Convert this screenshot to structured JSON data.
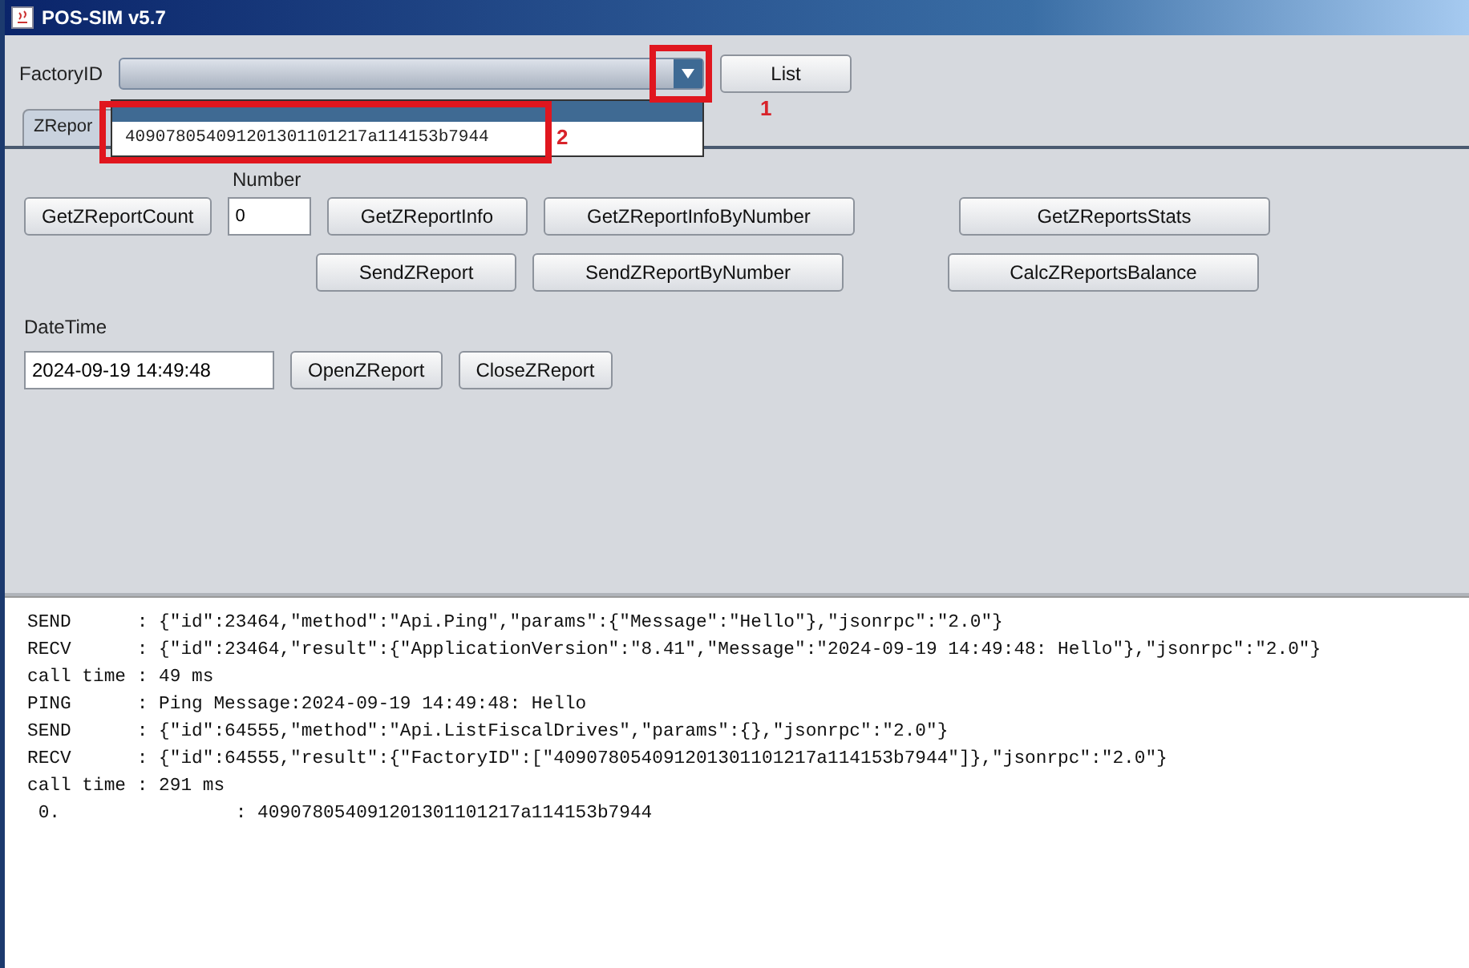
{
  "window": {
    "title": "POS-SIM v5.7"
  },
  "factory": {
    "label": "FactoryID",
    "open": true,
    "list_button": "List",
    "items": [
      {
        "selected": true
      },
      {
        "text": "409078054091201301101217a114153b7944",
        "selected": false
      }
    ]
  },
  "tabs": [
    {
      "label": "ZRepor",
      "selected": true
    }
  ],
  "panel": {
    "number_label": "Number",
    "number_value": "0",
    "datetime_label": "DateTime",
    "datetime_value": "2024-09-19 14:49:48",
    "row1": [
      "GetZReportCount",
      "GetZReportInfo",
      "GetZReportInfoByNumber",
      "GetZReportsStats"
    ],
    "row2": [
      "SendZReport",
      "SendZReportByNumber",
      "CalcZReportsBalance"
    ],
    "row3": [
      "OpenZReport",
      "CloseZReport"
    ]
  },
  "log": [
    "SEND      : {\"id\":23464,\"method\":\"Api.Ping\",\"params\":{\"Message\":\"Hello\"},\"jsonrpc\":\"2.0\"}",
    "RECV      : {\"id\":23464,\"result\":{\"ApplicationVersion\":\"8.41\",\"Message\":\"2024-09-19 14:49:48: Hello\"},\"jsonrpc\":\"2.0\"}",
    "call time : 49 ms",
    "PING      : Ping Message:2024-09-19 14:49:48: Hello",
    "SEND      : {\"id\":64555,\"method\":\"Api.ListFiscalDrives\",\"params\":{},\"jsonrpc\":\"2.0\"}",
    "RECV      : {\"id\":64555,\"result\":{\"FactoryID\":[\"409078054091201301101217a114153b7944\"]},\"jsonrpc\":\"2.0\"}",
    "call time : 291 ms",
    " 0.                : 409078054091201301101217a114153b7944"
  ],
  "annotations": [
    {
      "label": "1"
    },
    {
      "label": "2"
    }
  ]
}
